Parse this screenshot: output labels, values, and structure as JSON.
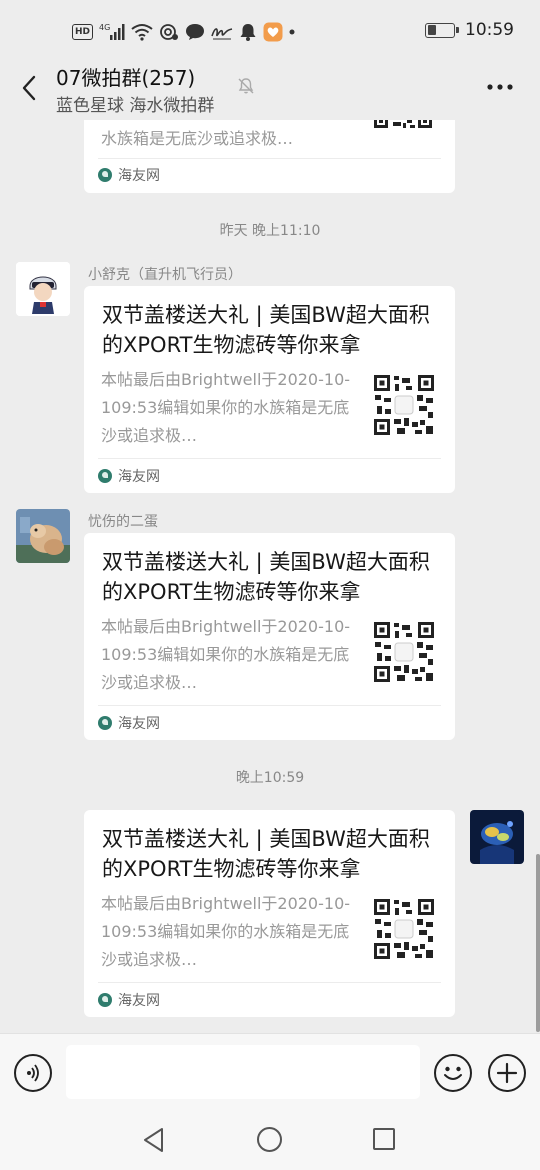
{
  "status_bar": {
    "icons": [
      "hd-icon",
      "4g-signal-icon",
      "wifi-icon",
      "hotspot-icon",
      "chat-bubble-icon",
      "signature-icon",
      "bell-icon",
      "heart-app-icon",
      "more-dots-icon"
    ],
    "hd_label": "HD",
    "net_label": "4G",
    "battery_level": 0.35,
    "time": "10:59"
  },
  "header": {
    "title": "07微拍群(257)",
    "subtitle": "蓝色星球 海水微拍群"
  },
  "messages": [
    {
      "type": "link-card-partial",
      "desc_tail": "水族箱是无底沙或追求极…",
      "source": "海友网"
    },
    {
      "type": "time",
      "text": "昨天 晚上11:10"
    },
    {
      "type": "link-card",
      "side": "left",
      "sender": "小舒克（直升机飞行员）",
      "title": "双节盖楼送大礼 | 美国BW超大面积的XPORT生物滤砖等你来拿",
      "desc": "本帖最后由Brightwell于2020-10-109:53编辑如果你的水族箱是无底沙或追求极…",
      "source": "海友网"
    },
    {
      "type": "link-card",
      "side": "left",
      "sender": "忧伤的二蛋",
      "title": "双节盖楼送大礼 | 美国BW超大面积的XPORT生物滤砖等你来拿",
      "desc": "本帖最后由Brightwell于2020-10-109:53编辑如果你的水族箱是无底沙或追求极…",
      "source": "海友网"
    },
    {
      "type": "time",
      "text": "晚上10:59"
    },
    {
      "type": "link-card",
      "side": "right",
      "title": "双节盖楼送大礼 | 美国BW超大面积的XPORT生物滤砖等你来拿",
      "desc": "本帖最后由Brightwell于2020-10-109:53编辑如果你的水族箱是无底沙或追求极…",
      "source": "海友网"
    }
  ],
  "input_bar": {
    "placeholder": ""
  },
  "colors": {
    "background": "#ededed",
    "card": "#ffffff",
    "source_icon": "#2f7c6d",
    "muted_text": "#999999"
  }
}
